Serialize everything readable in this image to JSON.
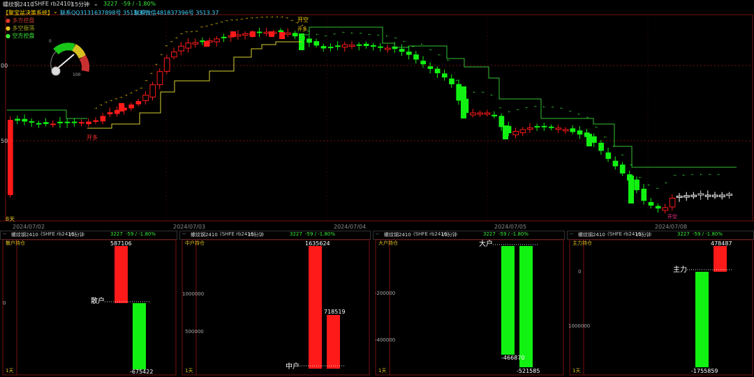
{
  "main": {
    "instrument": "螺纹钢2410",
    "code": "(SHFE rb2410)",
    "period": "15分钟",
    "price": "3227",
    "change": "-59 / -1.80%",
    "ticker_text": "【聚宝盆决策系统】",
    "qq_text": "联系QQ3131637898号  3513.37",
    "wx_text": "联系微信481837396号  3513.37",
    "legend": [
      "多方控盘",
      "多空振荡",
      "空方控盘"
    ],
    "axis_left": [
      "00",
      "50"
    ],
    "bottom_left_label": "8天",
    "dates": [
      "2024/07/02",
      "2024/07/03",
      "2024/07/04",
      "2024/07/05",
      "2024/07/08"
    ],
    "annotations": [
      "开多",
      "开空",
      "开多",
      "开空"
    ],
    "gauge": {
      "min": "0",
      "max": "100"
    }
  },
  "panels": [
    {
      "header_icon": "--",
      "title": "螺纹钢2410",
      "code": "(SHFE rb2410)",
      "period": "15分钟",
      "price": "3227",
      "change": "-59 / -1.80%",
      "sub": "散户持仓",
      "bottom": "1天",
      "label": "散户",
      "axis": [
        "0"
      ],
      "values": {
        "top": "587106",
        "bottom": "-675422"
      }
    },
    {
      "header_icon": "--",
      "title": "螺纹钢2410",
      "code": "(SHFE rb2410)",
      "period": "15分钟",
      "price": "3227",
      "change": "-59 / -1.80%",
      "sub": "中户持仓",
      "bottom": "1天",
      "label": "中户",
      "axis": [
        "1000000",
        "500000"
      ],
      "values": {
        "top": "1635624",
        "bottom": "718519"
      }
    },
    {
      "header_icon": "--",
      "title": "螺纹钢2410",
      "code": "(SHFE rb2410)",
      "period": "15分钟",
      "price": "3227",
      "change": "-59 / -1.80%",
      "sub": "大户持仓",
      "bottom": "1天",
      "label": "大户",
      "axis": [
        "-200000",
        "-400000"
      ],
      "values": {
        "left": "-466870",
        "right": "-521585"
      }
    },
    {
      "header_icon": "--",
      "title": "螺纹钢2410",
      "code": "(SHFE rb2410)",
      "period": "15分钟",
      "price": "3227",
      "change": "-59 / -1.80%",
      "sub": "主力持仓",
      "bottom": "1天",
      "label": "主力",
      "axis": [
        "0",
        "1000000"
      ],
      "values": {
        "top": "478487",
        "bottom": "-1755859"
      }
    }
  ],
  "colors": {
    "up": "#ff1a1a",
    "down": "#12f212",
    "text_red": "#e0392b",
    "text_cyan": "#3ed3ff",
    "grid": "#7a1010",
    "yellow": "#ffd400"
  }
}
